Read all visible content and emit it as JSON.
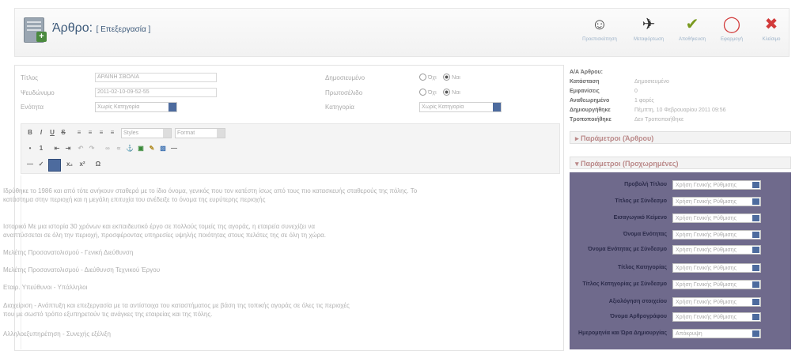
{
  "header": {
    "title": "Άρθρο:",
    "subtitle": "[ Επεξεργασία ]",
    "toolbar": [
      {
        "label": "Προεπισκόπηση",
        "icon": "person-icon"
      },
      {
        "label": "Μεταφόρτωση",
        "icon": "upload-icon"
      },
      {
        "label": "Αποθήκευση",
        "icon": "check-icon"
      },
      {
        "label": "Εφαρμογή",
        "icon": "apply-icon"
      },
      {
        "label": "Κλείσιμο",
        "icon": "close-icon"
      }
    ]
  },
  "form": {
    "title_label": "Τίτλος",
    "title_value": "ΑΡΑΙΝΗ ΣΒΟΛΙΑ",
    "alias_label": "Ψευδώνυμο",
    "alias_value": "2011-02-10-09-52-55",
    "section_label": "Ενότητα",
    "section_value": "Χωρίς Κατηγορία",
    "published_label": "Δημοσιευμένο",
    "frontpage_label": "Πρωτοσέλιδο",
    "category_label": "Κατηγορία",
    "category_value": "Χωρίς Κατηγορία",
    "radio_no": "Όχι",
    "radio_yes": "Ναι",
    "styles": "Styles",
    "format": "Format"
  },
  "editor": {
    "paragraphs": [
      "Ιδρύθηκε το 1986 και από τότε ανήκουν σταθερά με το ίδιο όνομα, γενικός που τον κατέστη ίσως από τους πιο κατασκευής σταθερούς της πόλης. Το",
      "κατάστημα στην περιοχή και η μεγάλη επιτυχία του ανέδειξε το όνομα της ευρύτερης περιοχής",
      "Ιστορικό Με μια ιστορία 30 χρόνων και εκπαιδευτικό έργο σε πολλούς τομείς της αγοράς, η εταιρεία συνεχίζει να",
      "αναπτύσσεται σε όλη την περιοχή, προσφέροντας υπηρεσίες υψηλής ποιότητας στους πελάτες της σε όλη τη χώρα.",
      "Μελέτης Προσανατολισμού - Γενική Διεύθυνση",
      "Μελέτης Προσανατολισμού - Διεύθυνση Τεχνικού Έργου",
      "Εταιρ. Υπεύθυνοι - Υπάλληλοι",
      "Διαχείριση - Ανάπτυξη και επεξεργασία με τα αντίστοιχα του καταστήματος με βάση της τοπικής αγοράς σε όλες τις περιοχές",
      "που με σωστό τρόπο εξυπηρετούν τις ανάγκες της εταιρείας και της πόλης.",
      "Αλληλοεξυπηρέτηση - Συνεχής εξέλιξη"
    ]
  },
  "info": {
    "id_label": "Α/Α Άρθρου:",
    "id_value": "",
    "state_label": "Κατάσταση",
    "state_value": "Δημοσιευμένο",
    "hits_label": "Εμφανίσεις",
    "hits_value": "0",
    "revised_label": "Αναθεωρημένο",
    "revised_value": "1 φορές",
    "created_label": "Δημιουργήθηκε",
    "created_value": "Πέμπτη, 10 Φεβρουαρίου 2011 09:56",
    "modified_label": "Τροποποιήθηκε",
    "modified_value": "Δεν Τροποποιήθηκε"
  },
  "params": {
    "article_header": "Παράμετροι (Άρθρου)",
    "advanced_header": "Παράμετροι (Προχωρημένες)",
    "default_value": "Χρήση Γενικής Ρύθμισης",
    "last_value": "Απόκρυψη",
    "rows": [
      "Προβολή Τίτλου",
      "Τίτλος με Σύνδεσμο",
      "Εισαγωγικό Κείμενο",
      "Όνομα Ενότητας",
      "Όνομα Ενότητας με Σύνδεσμο",
      "Τίτλος Κατηγορίας",
      "Τίτλος Κατηγορίας με Σύνδεσμο",
      "Αξιολόγηση στοιχείου",
      "Όνομα Αρθρογράφου",
      "Ημερομηνία και Ώρα Δημιουργίας"
    ]
  },
  "colors": {
    "accent": "#3d5a7a",
    "params_bg": "#6f6a8c"
  }
}
